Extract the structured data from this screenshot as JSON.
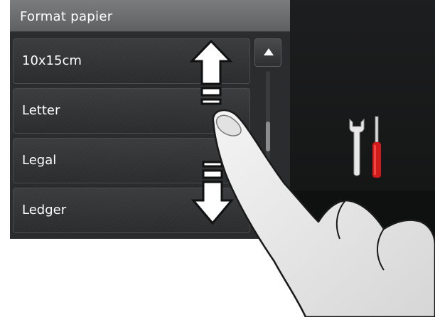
{
  "panel": {
    "title": "Format papier"
  },
  "paper_sizes": [
    {
      "label": "10x15cm"
    },
    {
      "label": "Letter"
    },
    {
      "label": "Legal"
    },
    {
      "label": "Ledger"
    }
  ],
  "scrollbar": {
    "position_fraction": 0.45
  },
  "icons": {
    "scroll_up": "triangle-up-icon",
    "tools": "wrench-screwdriver-icon",
    "gesture_up": "arrow-up-icon",
    "gesture_down": "arrow-down-icon",
    "finger": "pointing-hand-icon"
  },
  "colors": {
    "title_bar": "#6b6d6e",
    "list_item": "#333435",
    "screwdriver_handle": "#d11a1a"
  }
}
